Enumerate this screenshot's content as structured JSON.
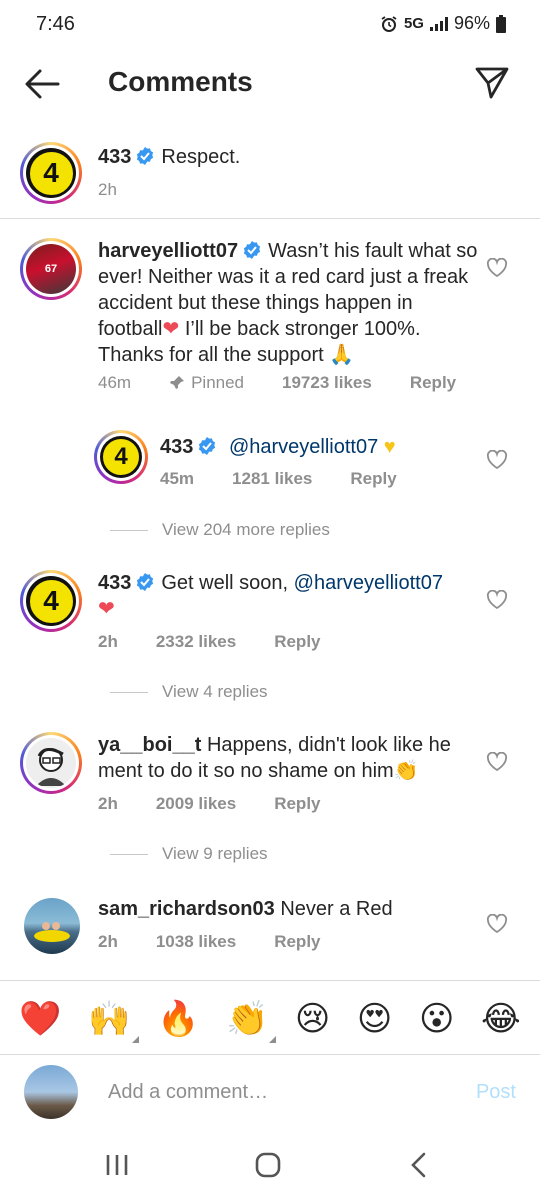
{
  "status": {
    "time": "7:46",
    "network": "5G",
    "battery": "96%"
  },
  "header": {
    "title": "Comments"
  },
  "caption": {
    "username": "433",
    "text": "Respect.",
    "time": "2h"
  },
  "comments": [
    {
      "username": "harveyelliott07",
      "text": "Wasn’t his fault what so ever! Neither was it a red card just a freak accident but these things happen in football",
      "text_after_heart": " I’ll be back stronger 100%. Thanks for all the support ",
      "time": "46m",
      "pinned": "Pinned",
      "likes": "19723 likes",
      "reply": "Reply"
    },
    {
      "username": "433",
      "mention": "@harveyelliott07",
      "time": "45m",
      "likes": "1281 likes",
      "reply": "Reply"
    },
    {
      "username": "433",
      "text": "Get well soon,",
      "mention": "@harveyelliott07",
      "time": "2h",
      "likes": "2332 likes",
      "reply": "Reply"
    },
    {
      "username": "ya__boi__t",
      "text": "Happens, didn't look like he ment to do it so no shame on him",
      "time": "2h",
      "likes": "2009 likes",
      "reply": "Reply"
    },
    {
      "username": "sam_richardson03",
      "text": "Never a Red",
      "time": "2h",
      "likes": "1038 likes",
      "reply": "Reply"
    }
  ],
  "view_replies": [
    "View 204 more replies",
    "View 4 replies",
    "View 9 replies"
  ],
  "emoji_bar": [
    "❤️",
    "🙌",
    "🔥",
    "👏",
    "😢",
    "😍",
    "😮",
    "😂"
  ],
  "input": {
    "placeholder": "Add a comment…",
    "post_label": "Post"
  },
  "colors": {
    "verified": "#3897f0",
    "mention": "#00376b",
    "heart": "#ed4956",
    "post": "#b2dffc"
  },
  "icons": [
    "back-arrow-icon",
    "send-icon",
    "verified-icon",
    "heart-outline-icon",
    "pin-icon",
    "recent-apps-icon",
    "home-icon",
    "back-nav-icon"
  ]
}
